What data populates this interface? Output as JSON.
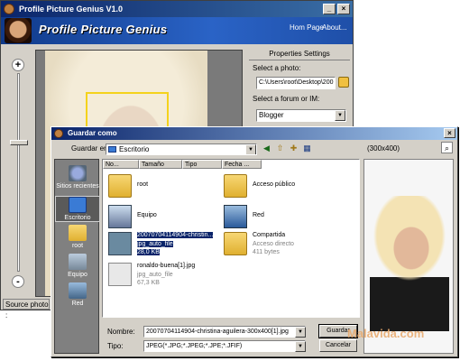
{
  "back_window": {
    "title": "Profile Picture Genius V1.0",
    "banner_logo": "Profile Picture Genius",
    "nav": {
      "home": "Hom Page",
      "about": "About..."
    },
    "zoom": {
      "plus": "+",
      "minus": "-"
    },
    "properties": {
      "title": "Properties Settings",
      "select_photo_label": "Select a photo:",
      "photo_path": "C:\\Users\\root\\Desktop\\200",
      "forum_label": "Select a forum or IM:",
      "forum_value": "Blogger"
    },
    "status": "Source photo :"
  },
  "dialog": {
    "title": "Guardar como",
    "save_in_label": "Guardar en:",
    "save_in_value": "Escritorio",
    "size_label": "(300x400)",
    "columns": [
      "No...",
      "Tamaño",
      "Tipo",
      "Fecha ..."
    ],
    "places": [
      {
        "label": "Sitios recientes",
        "icon": "recent-places-icon"
      },
      {
        "label": "Escritorio",
        "icon": "desktop-icon"
      },
      {
        "label": "root",
        "icon": "user-folder-icon"
      },
      {
        "label": "Equipo",
        "icon": "computer-icon"
      },
      {
        "label": "Red",
        "icon": "network-icon"
      }
    ],
    "files": [
      {
        "name": "root",
        "icon": "folder-user-icon"
      },
      {
        "name": "Acceso público",
        "icon": "folder-icon"
      },
      {
        "name": "Equipo",
        "icon": "computer-icon"
      },
      {
        "name": "Red",
        "icon": "network-icon"
      },
      {
        "name": "20070704114904-christin...",
        "sub1": "jpg_auto_file",
        "sub2": "28,0 KB",
        "icon": "image-file-icon"
      },
      {
        "name": "Compartida",
        "sub1": "Acceso directo",
        "sub2": "411 bytes",
        "icon": "shortcut-folder-icon"
      },
      {
        "name": "ronaldo-buena[1].jpg",
        "sub1": "jpg_auto_file",
        "sub2": "67,3 KB",
        "icon": "image-file-icon"
      }
    ],
    "filename_label": "Nombre:",
    "filename_value": "20070704114904-christina-aguilera-300x400[1].jpg",
    "type_label": "Tipo:",
    "type_value": "JPEG(*.JPG;*.JPEG;*.JPE;*.JFIF)",
    "save_button": "Guardar",
    "cancel_button": "Cancelar"
  },
  "watermark": "Malavida.com"
}
